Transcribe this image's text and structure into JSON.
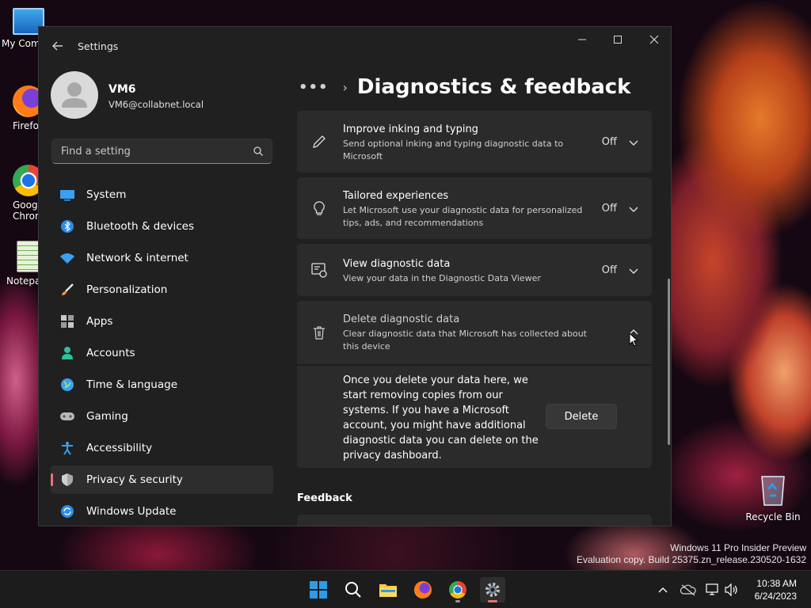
{
  "desktop": {
    "icons": [
      {
        "label": "My Com"
      },
      {
        "label": "Firefo"
      },
      {
        "label": "Goog Chron"
      },
      {
        "label": "Notepa"
      }
    ],
    "recycle_bin": "Recycle Bin",
    "watermark": {
      "line1": "Windows 11 Pro Insider Preview",
      "line2": "Evaluation copy. Build 25375.zn_release.230520-1632"
    }
  },
  "window": {
    "title": "Settings",
    "user": {
      "name": "VM6",
      "email": "VM6@collabnet.local"
    },
    "search": {
      "placeholder": "Find a setting",
      "value": ""
    },
    "nav": [
      {
        "label": "System",
        "icon": "system-icon"
      },
      {
        "label": "Bluetooth & devices",
        "icon": "bluetooth-icon"
      },
      {
        "label": "Network & internet",
        "icon": "wifi-icon"
      },
      {
        "label": "Personalization",
        "icon": "brush-icon"
      },
      {
        "label": "Apps",
        "icon": "apps-icon"
      },
      {
        "label": "Accounts",
        "icon": "person-icon"
      },
      {
        "label": "Time & language",
        "icon": "globe-icon"
      },
      {
        "label": "Gaming",
        "icon": "gamepad-icon"
      },
      {
        "label": "Accessibility",
        "icon": "accessibility-icon"
      },
      {
        "label": "Privacy & security",
        "icon": "shield-icon",
        "selected": true
      },
      {
        "label": "Windows Update",
        "icon": "update-icon"
      }
    ],
    "breadcrumb_dots": "•••",
    "page_title": "Diagnostics & feedback",
    "settings": [
      {
        "title": "Improve inking and typing",
        "desc": "Send optional inking and typing diagnostic data to Microsoft",
        "state": "Off",
        "icon": "pen-icon"
      },
      {
        "title": "Tailored experiences",
        "desc": "Let Microsoft use your diagnostic data for personalized tips, ads, and recommendations",
        "state": "Off",
        "icon": "lightbulb-icon"
      },
      {
        "title": "View diagnostic data",
        "desc": "View your data in the Diagnostic Data Viewer",
        "state": "Off",
        "icon": "data-viewer-icon"
      },
      {
        "title": "Delete diagnostic data",
        "desc": "Clear diagnostic data that Microsoft has collected about this device",
        "icon": "trash-icon",
        "expanded": true
      }
    ],
    "delete_panel": {
      "text": "Once you delete your data here, we start removing copies from our systems. If you have a Microsoft account, you might have additional diagnostic data you can delete on the privacy dashboard.",
      "button": "Delete"
    },
    "feedback_header": "Feedback"
  },
  "taskbar": {
    "time": "10:38 AM",
    "date": "6/24/2023",
    "accent": "#e8756c"
  }
}
